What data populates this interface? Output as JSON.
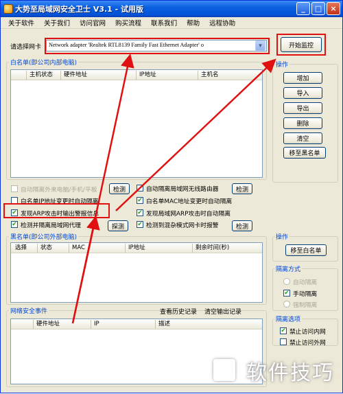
{
  "window": {
    "title": "大势至局域网安全卫士 V3.1 - 试用版",
    "controls": [
      "_",
      "□",
      "×"
    ]
  },
  "menu": [
    "关于软件",
    "关于我们",
    "访问官网",
    "购买流程",
    "联系我们",
    "帮助",
    "远程协助"
  ],
  "adapter": {
    "label": "请选择网卡",
    "value": "Network adapter 'Realtek RTL8139 Family Fast Ethernet Adapter' o",
    "start_button": "开始监控"
  },
  "whitelist": {
    "title": "白名单(即公司内部电脑)",
    "columns": [
      "主机状态",
      "硬件地址",
      "IP地址",
      "主机名"
    ]
  },
  "whitelist_ops": {
    "title": "操作",
    "buttons": [
      "增加",
      "导入",
      "导出",
      "删除",
      "清空",
      "移至黑名单"
    ]
  },
  "options": {
    "auto_isolate_foreign": "自动隔离外来电脑/手机/平板",
    "detect_1": "检测",
    "auto_isolate_wifi": "自动隔离局域网无线路由器",
    "detect_2": "检测",
    "whitelist_ip_change": "白名单IP地址变更时自动隔离",
    "whitelist_mac_change": "白名单MAC地址变更时自动隔离",
    "arp_alert": "发现ARP攻击时输出警报信息",
    "arp_isolate": "发现局域网ARP攻击时自动隔离",
    "detect_proxy": "检测并隔离局域网代理",
    "detect_3": "探测",
    "promisc_alert": "检测到混杂模式网卡时报警",
    "detect_4": "检测"
  },
  "blacklist": {
    "title": "黑名单(即公司外部电脑)",
    "columns": [
      "选择",
      "状态",
      "MAC",
      "IP地址",
      "剩余时间(秒)"
    ]
  },
  "blacklist_ops": {
    "title": "操作",
    "move_button": "移至白名单"
  },
  "isolation_mode": {
    "title": "隔离方式",
    "auto": "自动隔离",
    "manual": "手动隔离",
    "force": "强制隔离"
  },
  "isolation_options": {
    "title": "隔离选项",
    "block_internet": "禁止访问内网",
    "block_lan": "禁止访问外网"
  },
  "events": {
    "title": "网络安全事件",
    "history_link": "查看历史记录",
    "clear_link": "清空输出记录",
    "columns": [
      "硬件地址",
      "IP",
      "描述"
    ]
  },
  "watermark": "软件技巧",
  "colors": {
    "accent_red": "#e01010",
    "group_label_blue": "#0046d5",
    "title_blue": "#0454d8"
  }
}
